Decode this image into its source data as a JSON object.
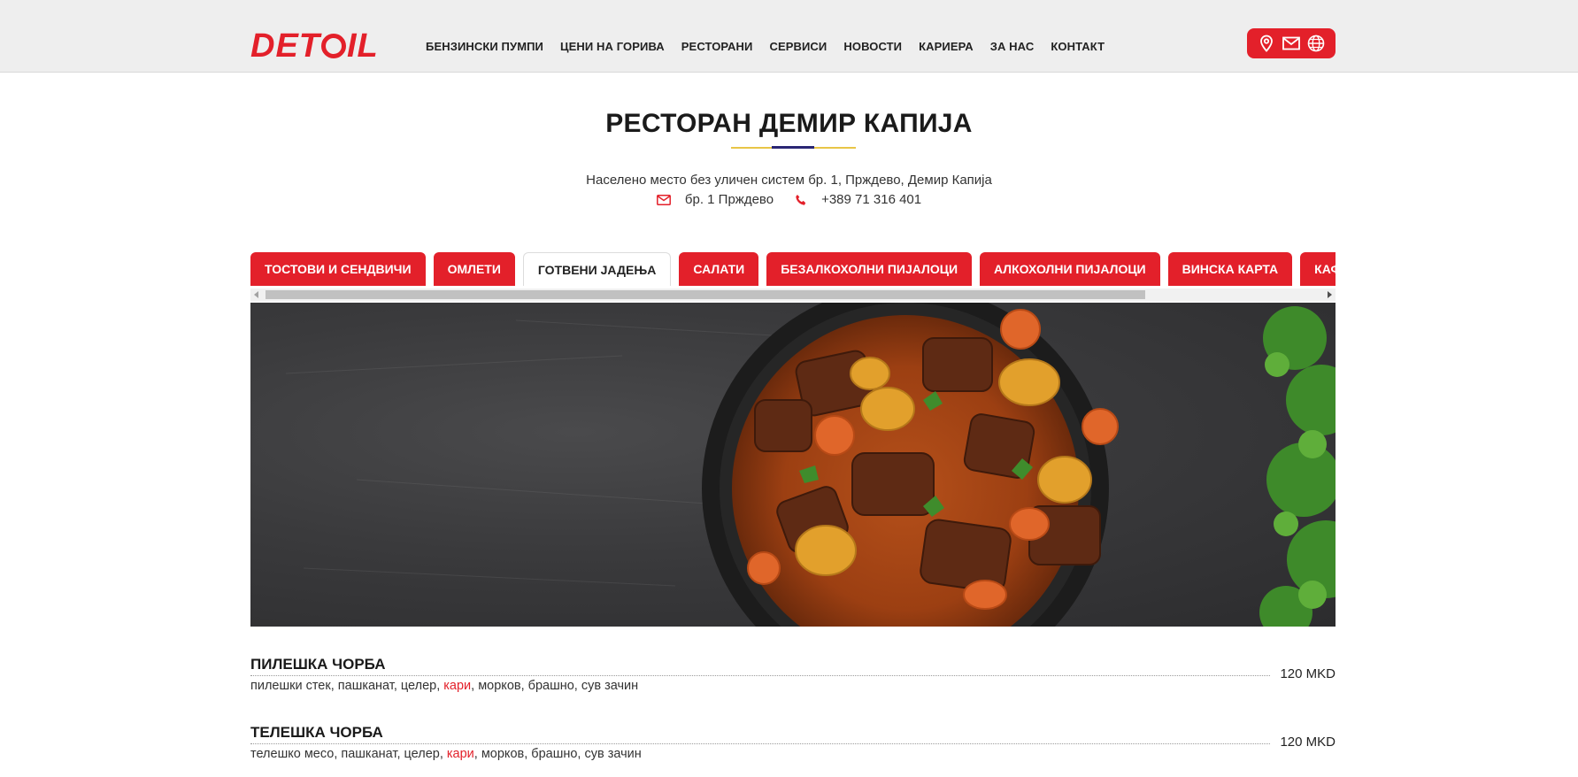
{
  "colors": {
    "brand": "#e3202a",
    "header_bg": "#eeeeee",
    "accent_yellow": "#e8c547",
    "accent_navy": "#2a2674"
  },
  "header": {
    "logo": "DETOIL",
    "nav": [
      "БЕНЗИНСКИ ПУМПИ",
      "ЦЕНИ НА ГОРИВА",
      "РЕСТОРАНИ",
      "СЕРВИСИ",
      "НОВОСТИ",
      "КАРИЕРА",
      "ЗА НАС",
      "КОНТАКТ"
    ],
    "icons": [
      "location-pin-icon",
      "mail-icon",
      "globe-icon"
    ]
  },
  "restaurant": {
    "title": "РЕСТОРАН ДЕМИР КАПИЈА",
    "address": "Населено место без уличен систем бр. 1, Прждево, Демир Капија",
    "email_line": "бр. 1 Прждево",
    "phone": "+389 71 316 401"
  },
  "tabs": [
    {
      "label": "ТОСТОВИ И СЕНДВИЧИ",
      "active": false
    },
    {
      "label": "ОМЛЕТИ",
      "active": false
    },
    {
      "label": "ГОТВЕНИ ЈАДЕЊА",
      "active": true
    },
    {
      "label": "САЛАТИ",
      "active": false
    },
    {
      "label": "БЕЗАЛКОХОЛНИ ПИЈАЛОЦИ",
      "active": false
    },
    {
      "label": "АЛКОХОЛНИ ПИЈАЛОЦИ",
      "active": false
    },
    {
      "label": "ВИНСКА КАРТА",
      "active": false
    },
    {
      "label": "КАФЕ И",
      "active": false
    }
  ],
  "menu": [
    {
      "name": "ПИЛЕШКА ЧОРБА",
      "price": "120 MKD",
      "desc_before": "пилешки стек, пашканат, целер, ",
      "desc_highlight": "кари",
      "desc_after": ", морков, брашно, сув зачин"
    },
    {
      "name": "ТЕЛЕШКА ЧОРБА",
      "price": "120 MKD",
      "desc_before": "телешко месо, пашканат, целер, ",
      "desc_highlight": "кари",
      "desc_after": ", морков, брашно, сув зачин"
    }
  ]
}
